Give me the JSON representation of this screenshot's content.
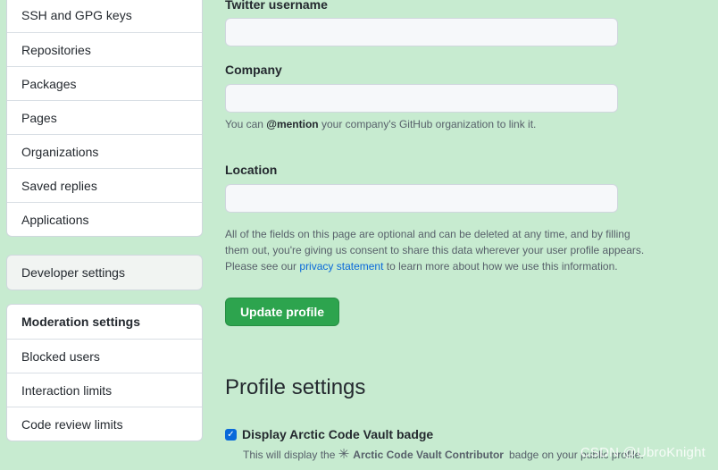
{
  "sidebar": {
    "group1": [
      "SSH and GPG keys",
      "Repositories",
      "Packages",
      "Pages",
      "Organizations",
      "Saved replies",
      "Applications"
    ],
    "developer_settings": "Developer settings",
    "moderation_heading": "Moderation settings",
    "moderation_items": [
      "Blocked users",
      "Interaction limits",
      "Code review limits"
    ]
  },
  "form": {
    "twitter_label": "Twitter username",
    "company_label": "Company",
    "company_note_prefix": "You can ",
    "company_note_mention": "@mention",
    "company_note_suffix": " your company's GitHub organization to link it.",
    "location_label": "Location",
    "privacy_note_1": "All of the fields on this page are optional and can be deleted at any time, and by filling them out, you're giving us consent to share this data wherever your user profile appears. Please see our ",
    "privacy_link": "privacy statement",
    "privacy_note_2": " to learn more about how we use this information.",
    "update_button": "Update profile"
  },
  "profile_settings": {
    "heading": "Profile settings",
    "checkbox_label": "Display Arctic Code Vault badge",
    "checkbox_checked": true,
    "desc_prefix": "This will display the",
    "badge_name": "Arctic Code Vault Contributor",
    "desc_suffix": "badge on your public profile."
  },
  "watermark": "CSDN @UbroKnight"
}
